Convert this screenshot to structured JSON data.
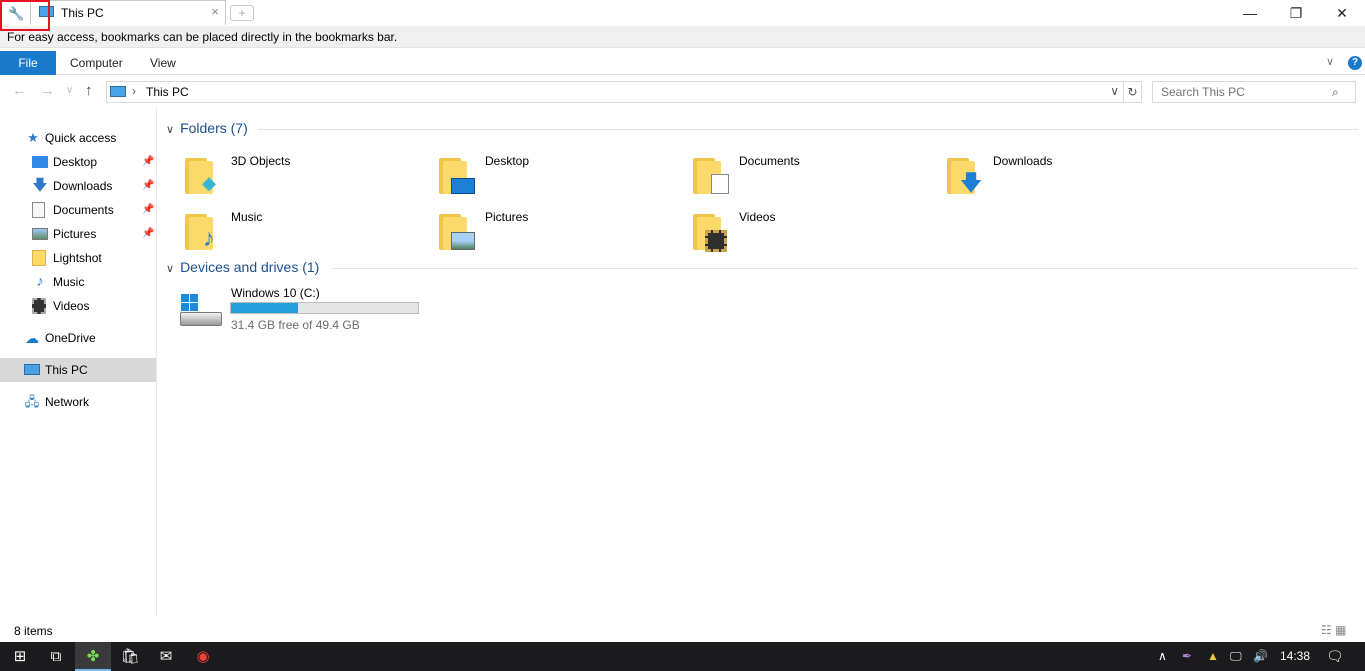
{
  "window": {
    "tab_title": "This PC",
    "tab_close": "×",
    "new_tab": "+",
    "minimize": "—",
    "restore": "❐",
    "close": "✕"
  },
  "bookmarks_bar": {
    "message": "For easy access, bookmarks can be placed directly in the bookmarks bar."
  },
  "ribbon": {
    "tabs": [
      "File",
      "Computer",
      "View"
    ],
    "help": "?"
  },
  "address": {
    "crumb": "This PC",
    "separator": "›",
    "search_placeholder": "Search This PC"
  },
  "sidebar": {
    "quick_access": "Quick access",
    "pinned": [
      "Desktop",
      "Downloads",
      "Documents",
      "Pictures"
    ],
    "recent": [
      "Lightshot",
      "Music",
      "Videos"
    ],
    "onedrive": "OneDrive",
    "this_pc": "This PC",
    "network": "Network"
  },
  "content": {
    "folders_header": "Folders (7)",
    "folders": [
      "3D Objects",
      "Desktop",
      "Documents",
      "Downloads",
      "Music",
      "Pictures",
      "Videos"
    ],
    "devices_header": "Devices and drives (1)",
    "drive": {
      "name": "Windows 10 (C:)",
      "free_text": "31.4 GB free of 49.4 GB",
      "used_fraction": 0.36
    }
  },
  "status": {
    "item_count": "8 items"
  },
  "taskbar": {
    "time": "14:38"
  },
  "colors": {
    "accent": "#1979ca",
    "drive_bar": "#26a0da",
    "folder": "#fbd96b",
    "selection": "#d9d9d9"
  }
}
